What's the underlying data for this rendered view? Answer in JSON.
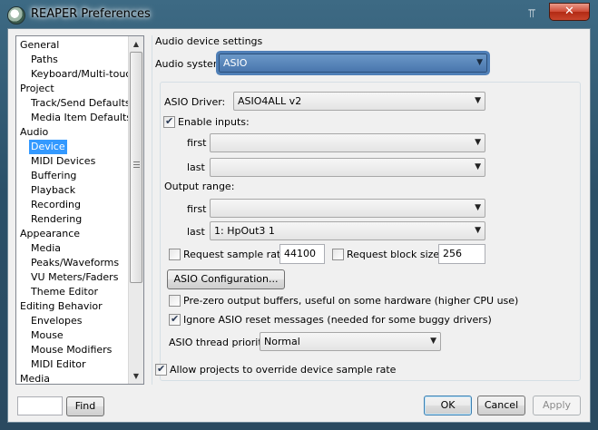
{
  "window": {
    "title": "REAPER Preferences",
    "pin_glyph": "⫪",
    "close_glyph": "✕"
  },
  "tree": {
    "items": [
      {
        "label": "General",
        "level": 0
      },
      {
        "label": "Paths",
        "level": 1
      },
      {
        "label": "Keyboard/Multi-touch",
        "level": 1
      },
      {
        "label": "Project",
        "level": 0
      },
      {
        "label": "Track/Send Defaults",
        "level": 1
      },
      {
        "label": "Media Item Defaults",
        "level": 1
      },
      {
        "label": "Audio",
        "level": 0
      },
      {
        "label": "Device",
        "level": 1,
        "selected": true
      },
      {
        "label": "MIDI Devices",
        "level": 1
      },
      {
        "label": "Buffering",
        "level": 1
      },
      {
        "label": "Playback",
        "level": 1
      },
      {
        "label": "Recording",
        "level": 1
      },
      {
        "label": "Rendering",
        "level": 1
      },
      {
        "label": "Appearance",
        "level": 0
      },
      {
        "label": "Media",
        "level": 1
      },
      {
        "label": "Peaks/Waveforms",
        "level": 1
      },
      {
        "label": "VU Meters/Faders",
        "level": 1
      },
      {
        "label": "Theme Editor",
        "level": 1
      },
      {
        "label": "Editing Behavior",
        "level": 0
      },
      {
        "label": "Envelopes",
        "level": 1
      },
      {
        "label": "Mouse",
        "level": 1
      },
      {
        "label": "Mouse Modifiers",
        "level": 1
      },
      {
        "label": "MIDI Editor",
        "level": 1
      },
      {
        "label": "Media",
        "level": 0
      }
    ],
    "scroll_up": "▲",
    "scroll_down": "▼"
  },
  "find": {
    "value": "",
    "button_label": "Find"
  },
  "audio": {
    "section_title": "Audio device settings",
    "system_label": "Audio system:",
    "system_value": "ASIO",
    "driver_label": "ASIO Driver:",
    "driver_value": "ASIO4ALL v2",
    "enable_inputs_label": "Enable inputs:",
    "enable_inputs_checked": true,
    "input_first_label": "first",
    "input_first_value": "",
    "input_last_label": "last",
    "input_last_value": "",
    "output_range_label": "Output range:",
    "output_first_label": "first",
    "output_first_value": "",
    "output_last_label": "last",
    "output_last_value": "1: HpOut3 1",
    "request_rate_label": "Request sample rate:",
    "request_rate_checked": false,
    "request_rate_value": "44100",
    "request_block_label": "Request block size:",
    "request_block_checked": false,
    "request_block_value": "256",
    "asio_config_label": "ASIO Configuration...",
    "prezero_label": "Pre-zero output buffers, useful on some hardware (higher CPU use)",
    "prezero_checked": false,
    "ignore_reset_label": "Ignore ASIO reset messages (needed for some buggy drivers)",
    "ignore_reset_checked": true,
    "thread_priority_label": "ASIO thread priority:",
    "thread_priority_value": "Normal",
    "allow_override_label": "Allow projects to override device sample rate",
    "allow_override_checked": true,
    "dropdown_glyph": "▼"
  },
  "buttons": {
    "ok": "OK",
    "cancel": "Cancel",
    "apply": "Apply"
  }
}
